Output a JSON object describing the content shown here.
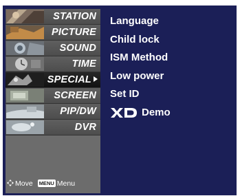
{
  "menu": {
    "items": [
      {
        "label": "STATION",
        "icon": "station-thumbnail"
      },
      {
        "label": "PICTURE",
        "icon": "picture-thumbnail"
      },
      {
        "label": "SOUND",
        "icon": "sound-thumbnail"
      },
      {
        "label": "TIME",
        "icon": "time-thumbnail"
      },
      {
        "label": "SPECIAL",
        "icon": "special-thumbnail",
        "active": true
      },
      {
        "label": "SCREEN",
        "icon": "screen-thumbnail"
      },
      {
        "label": "PIP/DW",
        "icon": "pipdw-thumbnail"
      },
      {
        "label": "DVR",
        "icon": "dvr-thumbnail"
      }
    ]
  },
  "hint": {
    "move": "Move",
    "menu_key": "MENU",
    "menu": "Menu"
  },
  "submenu": {
    "options": [
      "Language",
      "Child lock",
      "ISM Method",
      "Low power",
      "Set ID",
      "Demo"
    ],
    "xd_logo": "XD"
  },
  "colors": {
    "panel": "#1b1f57",
    "sidebar": "#5f5f5f",
    "active": "#1a1a1a",
    "text": "#ffffff"
  }
}
